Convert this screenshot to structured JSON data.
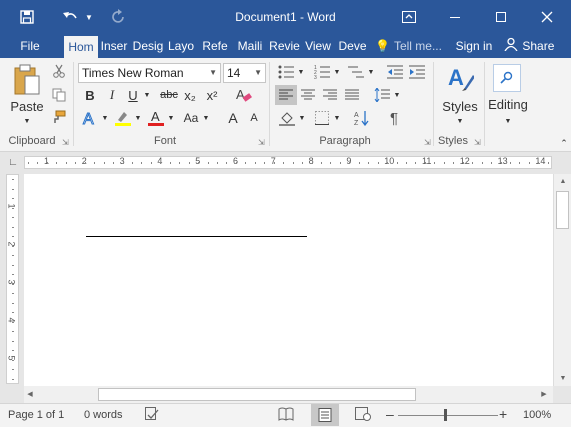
{
  "window": {
    "title": "Document1 - Word",
    "accent_color": "#2b579a"
  },
  "quick_access": {
    "save_icon": "save-icon",
    "undo_icon": "undo-icon",
    "redo_icon": "redo-icon"
  },
  "tabs": [
    {
      "label": "File"
    },
    {
      "label": "Hom"
    },
    {
      "label": "Inser"
    },
    {
      "label": "Desig"
    },
    {
      "label": "Layo"
    },
    {
      "label": "Refe"
    },
    {
      "label": "Maili"
    },
    {
      "label": "Revie"
    },
    {
      "label": "View"
    },
    {
      "label": "Deve"
    }
  ],
  "tell_me": "Tell me...",
  "sign_in": "Sign in",
  "share": "Share",
  "ribbon": {
    "clipboard": {
      "label": "Clipboard",
      "paste": "Paste"
    },
    "font": {
      "label": "Font",
      "family": "Times New Roman",
      "size": "14",
      "bold": "B",
      "italic": "I",
      "underline": "U",
      "strike": "abc",
      "subscript": "x₂",
      "superscript": "x²",
      "grow": "A",
      "shrink": "A",
      "case": "Aa"
    },
    "paragraph": {
      "label": "Paragraph"
    },
    "styles": {
      "label": "Styles",
      "button": "Styles"
    },
    "editing": {
      "button": "Editing"
    }
  },
  "ruler": {
    "labels": [
      "1",
      "1",
      "2",
      "3",
      "4",
      "5",
      "6",
      "7",
      "8",
      "9",
      "10",
      "11",
      "12",
      "13",
      "14"
    ],
    "vlabels": [
      "1",
      "1",
      "2",
      "3",
      "4",
      "5"
    ]
  },
  "status": {
    "page": "Page 1 of 1",
    "words": "0 words",
    "zoom": "100%",
    "zoom_minus": "–",
    "zoom_plus": "+"
  }
}
